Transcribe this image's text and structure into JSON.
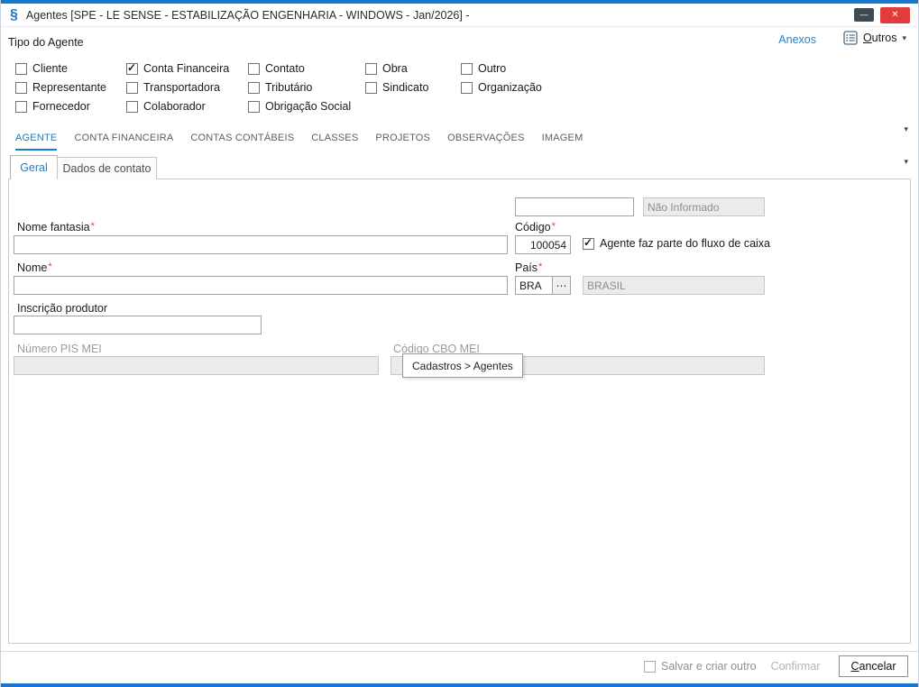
{
  "colors": {
    "accent": "#1877cf",
    "link": "#1e86d8",
    "tab-active": "#1a7fc6",
    "required": "#e53935",
    "close": "#e23b3b"
  },
  "icons": {
    "app": "§",
    "caret": "▾",
    "close": "✕",
    "minimize": "—",
    "ellipsis": "⋯",
    "required": "*"
  },
  "window": {
    "title": "Agentes [SPE - LE SENSE - ESTABILIZAÇÃO ENGENHARIA - WINDOWS - Jan/2026]  -"
  },
  "toolbar": {
    "section_title": "Tipo do Agente",
    "anexos": "Anexos",
    "outros": {
      "accel": "O",
      "rest": "utros"
    }
  },
  "agent_types": [
    {
      "label": "Cliente",
      "checked": false
    },
    {
      "label": "Conta Financeira",
      "checked": true
    },
    {
      "label": "Contato",
      "checked": false
    },
    {
      "label": "Obra",
      "checked": false
    },
    {
      "label": "Outro",
      "checked": false
    },
    {
      "label": "Representante",
      "checked": false
    },
    {
      "label": "Transportadora",
      "checked": false
    },
    {
      "label": "Tributário",
      "checked": false
    },
    {
      "label": "Sindicato",
      "checked": false
    },
    {
      "label": "Organização",
      "checked": false
    },
    {
      "label": "Fornecedor",
      "checked": false
    },
    {
      "label": "Colaborador",
      "checked": false
    },
    {
      "label": "Obrigação Social",
      "checked": false
    }
  ],
  "tabs": {
    "main": [
      "AGENTE",
      "CONTA FINANCEIRA",
      "CONTAS CONTÁBEIS",
      "CLASSES",
      "PROJETOS",
      "OBSERVAÇÕES",
      "IMAGEM"
    ],
    "active_main": "AGENTE",
    "sub": [
      "Geral",
      "Dados de contato"
    ],
    "active_sub": "Geral"
  },
  "form": {
    "top_code": {
      "value": ""
    },
    "top_desc": {
      "value": "Não Informado"
    },
    "nome_fantasia": {
      "label": "Nome fantasia",
      "value": ""
    },
    "codigo": {
      "label": "Código",
      "value": "100054"
    },
    "fluxo_caixa": {
      "label": "Agente faz parte do fluxo de caixa",
      "checked": true
    },
    "nome": {
      "label": "Nome",
      "value": ""
    },
    "pais": {
      "label": "País",
      "value": "BRA",
      "desc": "BRASIL"
    },
    "inscricao_produtor": {
      "label": "Inscrição produtor",
      "value": ""
    },
    "numero_pis_mei": {
      "label": "Número PIS MEI",
      "value": ""
    },
    "codigo_cbo_mei": {
      "label": "Código CBO MEI",
      "value": "",
      "desc": ""
    },
    "tooltip": "Cadastros > Agentes"
  },
  "footer": {
    "salvar_criar_outro": {
      "label": "Salvar e criar outro",
      "checked": false
    },
    "confirmar": "Confirmar",
    "cancelar": {
      "accel": "C",
      "rest": "ancelar"
    }
  }
}
